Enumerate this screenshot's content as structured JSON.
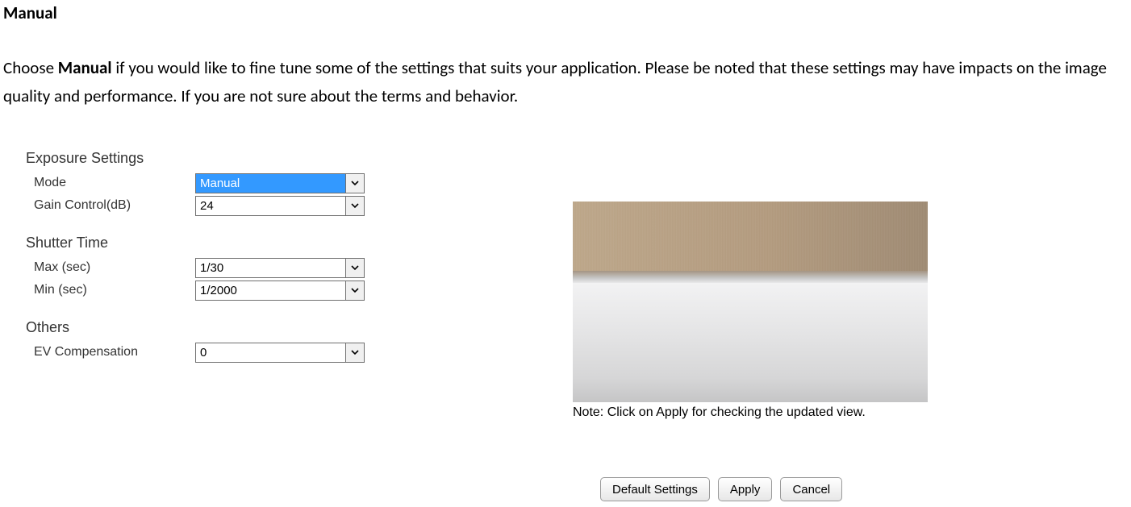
{
  "doc": {
    "title": "Manual",
    "para_pre": "Choose ",
    "para_bold": "Manual",
    "para_post": " if you would like to fine tune some of the settings that suits your application. Please be noted that these settings may have impacts on the image quality and performance. If you are not sure about the terms and behavior."
  },
  "exposure": {
    "title": "Exposure Settings",
    "mode_label": "Mode",
    "mode_value": "Manual",
    "gain_label": "Gain Control(dB)",
    "gain_value": "24"
  },
  "shutter": {
    "title": "Shutter Time",
    "max_label": "Max (sec)",
    "max_value": "1/30",
    "min_label": "Min (sec)",
    "min_value": "1/2000"
  },
  "others": {
    "title": "Others",
    "ev_label": "EV Compensation",
    "ev_value": "0"
  },
  "preview_note": "Note: Click on Apply for checking the updated view.",
  "buttons": {
    "defaults": "Default Settings",
    "apply": "Apply",
    "cancel": "Cancel"
  }
}
